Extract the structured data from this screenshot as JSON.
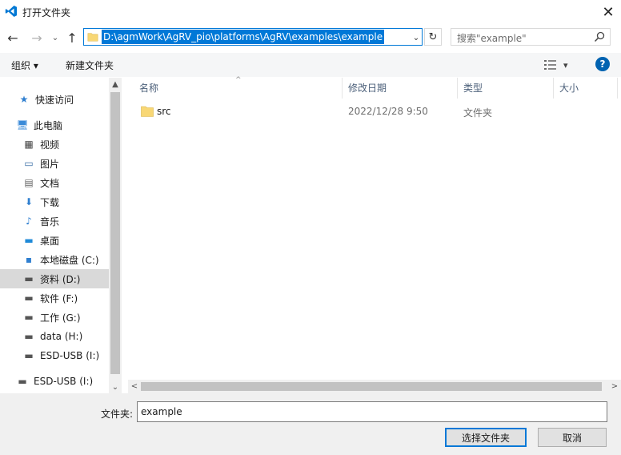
{
  "window": {
    "title": "打开文件夹",
    "close_glyph": "✕"
  },
  "nav": {
    "back_glyph": "←",
    "forward_glyph": "→",
    "recent_glyph": "⌄",
    "up_glyph": "↑",
    "address": "D:\\agmWork\\AgRV_pio\\platforms\\AgRV\\examples\\example",
    "address_dropdown_glyph": "⌄",
    "refresh_glyph": "↻",
    "search_placeholder": "搜索\"example\""
  },
  "toolbar": {
    "organize_label": "组织 ▾",
    "new_folder_label": "新建文件夹",
    "view_glyph": "▾",
    "help_glyph": "?"
  },
  "sidebar": {
    "items": [
      {
        "label": "快速访问",
        "icon": "star-icon",
        "glyph": "★",
        "color": "#2f7fd0"
      },
      {
        "label": "此电脑",
        "icon": "computer-icon",
        "glyph": "🖥",
        "color": "#3a8ad8"
      },
      {
        "label": "视频",
        "icon": "video-icon",
        "glyph": "▦",
        "color": "#444444"
      },
      {
        "label": "图片",
        "icon": "picture-icon",
        "glyph": "▭",
        "color": "#3a6ea5"
      },
      {
        "label": "文档",
        "icon": "document-icon",
        "glyph": "▤",
        "color": "#666666"
      },
      {
        "label": "下载",
        "icon": "download-icon",
        "glyph": "⬇",
        "color": "#2f7fd0"
      },
      {
        "label": "音乐",
        "icon": "music-icon",
        "glyph": "♪",
        "color": "#2f7fd0"
      },
      {
        "label": "桌面",
        "icon": "desktop-icon",
        "glyph": "▬",
        "color": "#1f8ad8"
      },
      {
        "label": "本地磁盘 (C:)",
        "icon": "windows-drive-icon",
        "glyph": "▪",
        "color": "#2f7fd0"
      },
      {
        "label": "资料 (D:)",
        "icon": "drive-icon",
        "glyph": "▬",
        "color": "#555555"
      },
      {
        "label": "软件 (F:)",
        "icon": "drive-icon",
        "glyph": "▬",
        "color": "#555555"
      },
      {
        "label": "工作 (G:)",
        "icon": "drive-icon",
        "glyph": "▬",
        "color": "#555555"
      },
      {
        "label": "data (H:)",
        "icon": "drive-icon",
        "glyph": "▬",
        "color": "#555555"
      },
      {
        "label": "ESD-USB (I:)",
        "icon": "drive-icon",
        "glyph": "▬",
        "color": "#555555"
      },
      {
        "label": "ESD-USB (I:)",
        "icon": "drive-icon",
        "glyph": "▬",
        "color": "#555555"
      }
    ],
    "scroll_up_glyph": "▲",
    "scroll_down_glyph": "⌄"
  },
  "columns": {
    "name": "名称",
    "modified": "修改日期",
    "type": "类型",
    "size": "大小",
    "sort_glyph": "^"
  },
  "files": [
    {
      "name": "src",
      "modified": "2022/12/28 9:50",
      "type": "文件夹"
    }
  ],
  "hscroll": {
    "left_glyph": "<",
    "right_glyph": ">"
  },
  "bottom": {
    "folder_label": "文件夹:",
    "folder_value": "example",
    "select_button": "选择文件夹",
    "cancel_button": "取消"
  },
  "colors": {
    "accent": "#0078d7",
    "help": "#0063b1",
    "folder": "#f8d775"
  }
}
